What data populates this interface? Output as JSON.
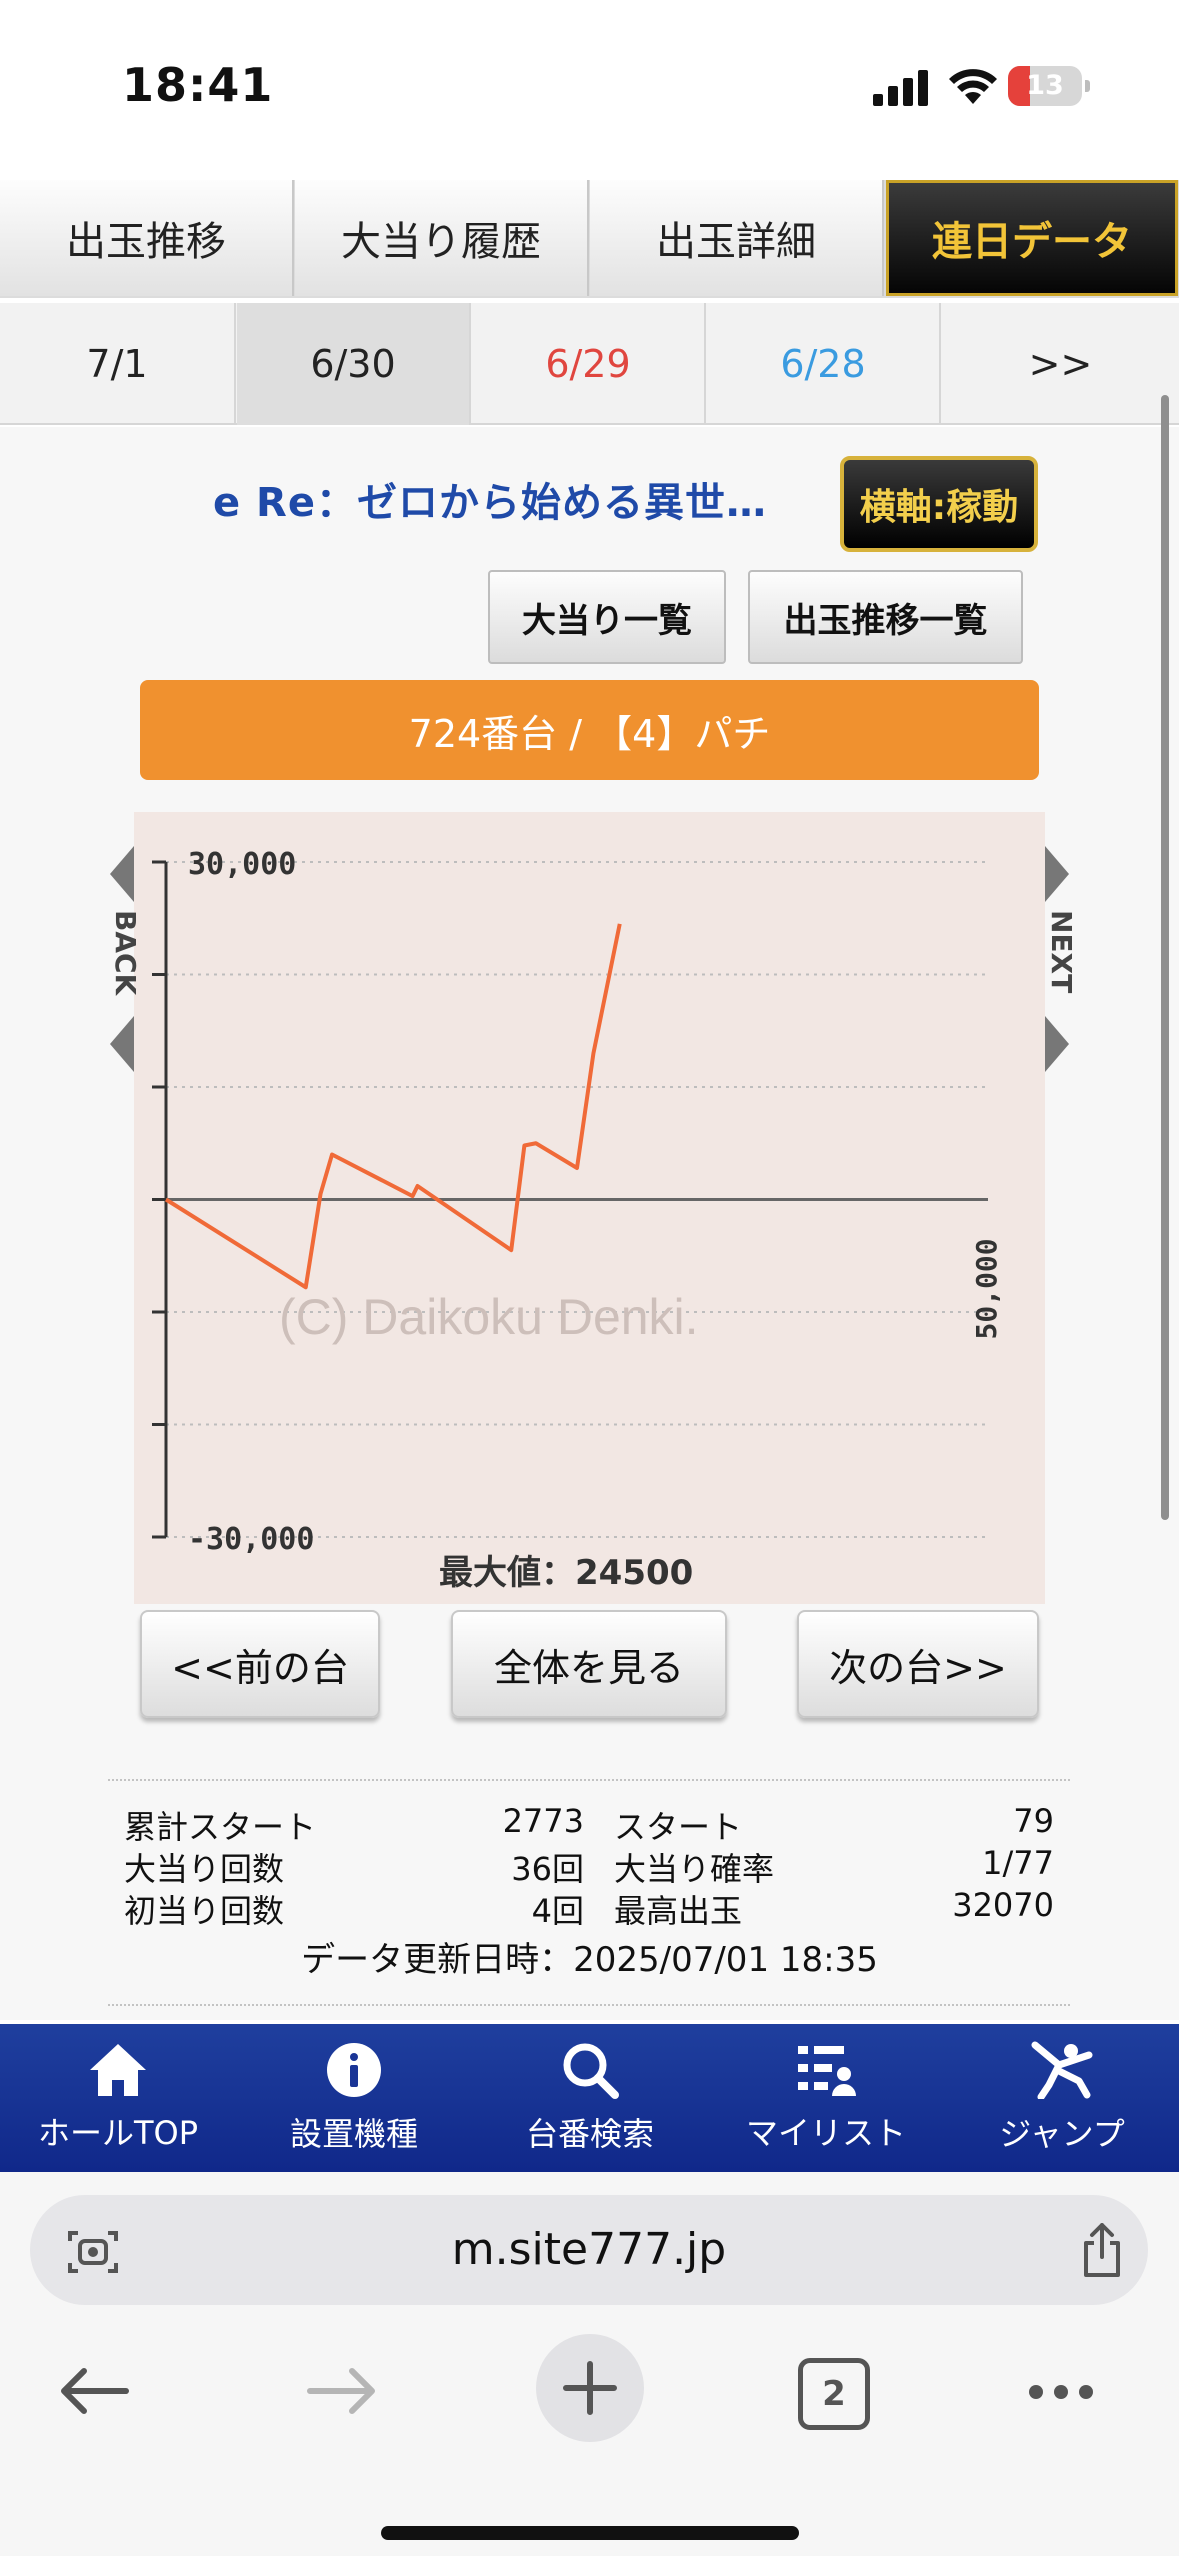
{
  "status": {
    "time": "18:41",
    "battery": "13"
  },
  "tabs": [
    {
      "label": "出玉推移"
    },
    {
      "label": "大当り履歴"
    },
    {
      "label": "出玉詳細"
    },
    {
      "label": "連日データ"
    }
  ],
  "dates": [
    {
      "label": "7/1",
      "color": "#222222"
    },
    {
      "label": "6/30",
      "color": "#222222"
    },
    {
      "label": "6/29",
      "color": "#e0463f"
    },
    {
      "label": "6/28",
      "color": "#3a9be0"
    },
    {
      "label": ">>",
      "color": "#222222"
    }
  ],
  "machine": {
    "name": "e Re：ゼロから始める異世…",
    "axis_button": "横軸:稼動"
  },
  "buttons": {
    "jackpot_list": "大当り一覧",
    "payout_list": "出玉推移一覧"
  },
  "unit_bar": "724番台 / 【4】パチ",
  "chart_data": {
    "type": "line",
    "title": "",
    "xlabel": "",
    "ylabel": "",
    "ylim": [
      -30000,
      30000
    ],
    "xlim": [
      0,
      50000
    ],
    "y_ticks": [
      30000,
      20000,
      10000,
      0,
      -10000,
      -20000,
      -30000
    ],
    "y_tick_labels": [
      "30,000",
      "",
      "",
      "",
      "",
      "",
      "-30,000"
    ],
    "x_end_label": "50,000",
    "grid": true,
    "watermark": "(C) Daikoku Denki.",
    "max_label": "最大値：24500",
    "side_labels": {
      "left": "BACK",
      "right": "NEXT"
    },
    "line_color": "#f06a38",
    "series": [
      {
        "x": [
          0,
          8500,
          9400,
          10100,
          15000,
          15300,
          21000,
          21800,
          22500,
          25000,
          26000,
          27600
        ],
        "y": [
          0,
          -7800,
          500,
          4000,
          300,
          1200,
          -4500,
          4800,
          5000,
          2800,
          13000,
          24500
        ]
      }
    ]
  },
  "nav": {
    "prev": "<<前の台",
    "all": "全体を見る",
    "next": "次の台>>"
  },
  "stats": {
    "left": [
      {
        "label": "累計スタート",
        "value": "2773"
      },
      {
        "label": "大当り回数",
        "value": "36回"
      },
      {
        "label": "初当り回数",
        "value": "4回"
      }
    ],
    "right": [
      {
        "label": "スタート",
        "value": "79"
      },
      {
        "label": "大当り確率",
        "value": "1/77"
      },
      {
        "label": "最高出玉",
        "value": "32070"
      }
    ],
    "updated": "データ更新日時：2025/07/01 18:35"
  },
  "appnav": [
    {
      "label": "ホールTOP",
      "icon": "home-icon"
    },
    {
      "label": "設置機種",
      "icon": "info-icon"
    },
    {
      "label": "台番検索",
      "icon": "search-icon"
    },
    {
      "label": "マイリスト",
      "icon": "list-icon"
    },
    {
      "label": "ジャンプ",
      "icon": "jump-icon"
    }
  ],
  "browser": {
    "url": "m.site777.jp",
    "tab_count": "2"
  }
}
